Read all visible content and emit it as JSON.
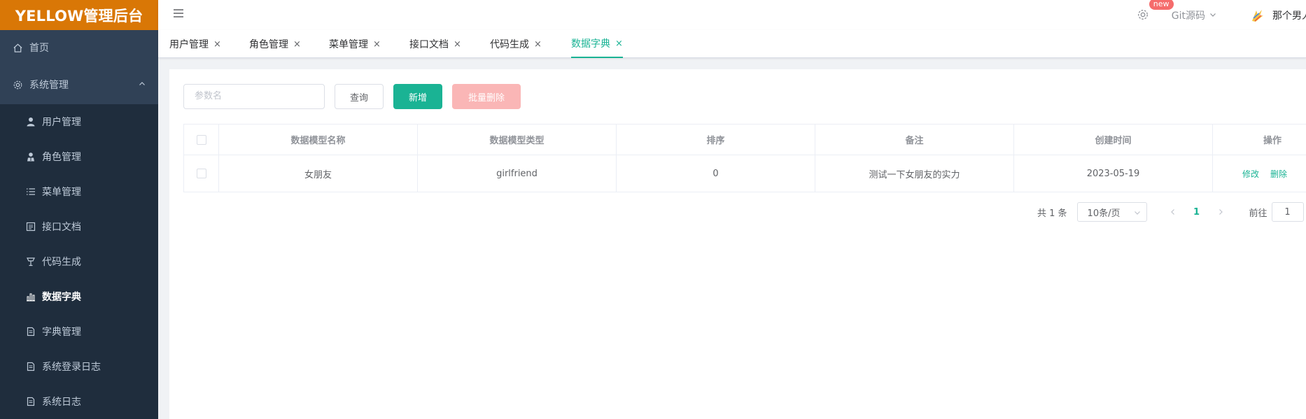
{
  "sidebar": {
    "logo": "YELLOW管理后台",
    "home": "首页",
    "group": "系统管理",
    "items": [
      {
        "label": "用户管理",
        "icon": "user-icon"
      },
      {
        "label": "角色管理",
        "icon": "role-icon"
      },
      {
        "label": "菜单管理",
        "icon": "menu-list-icon"
      },
      {
        "label": "接口文档",
        "icon": "api-doc-icon"
      },
      {
        "label": "代码生成",
        "icon": "code-gen-icon"
      },
      {
        "label": "数据字典",
        "icon": "chart-icon"
      },
      {
        "label": "字典管理",
        "icon": "document-icon"
      },
      {
        "label": "系统登录日志",
        "icon": "document-icon"
      },
      {
        "label": "系统日志",
        "icon": "document-icon"
      }
    ]
  },
  "navbar": {
    "badge": "new",
    "git_label": "Git源码",
    "user_name": "那个男人"
  },
  "tags": [
    {
      "label": "用户管理",
      "close": "×"
    },
    {
      "label": "角色管理",
      "close": "×"
    },
    {
      "label": "菜单管理",
      "close": "×"
    },
    {
      "label": "接口文档",
      "close": "×"
    },
    {
      "label": "代码生成",
      "close": "×"
    },
    {
      "label": "数据字典",
      "close": "×"
    }
  ],
  "toolbar": {
    "search_placeholder": "参数名",
    "query_label": "查询",
    "add_label": "新增",
    "bulk_delete_label": "批量删除"
  },
  "table": {
    "columns": [
      "数据模型名称",
      "数据模型类型",
      "排序",
      "备注",
      "创建时间",
      "操作"
    ],
    "rows": [
      {
        "name": "女朋友",
        "type": "girlfriend",
        "sort": "0",
        "remark": "测试一下女朋友的实力",
        "created": "2023-05-19",
        "edit": "修改",
        "delete": "删除"
      }
    ]
  },
  "pagination": {
    "total": "共 1 条",
    "page_size": "10条/页",
    "current": "1",
    "goto": "前往",
    "goto_value": "1"
  },
  "colors": {
    "accent": "#1ab394",
    "sidebar_bg": "#304156",
    "logo_bg": "#d97706",
    "danger_light": "#fab6b6"
  }
}
